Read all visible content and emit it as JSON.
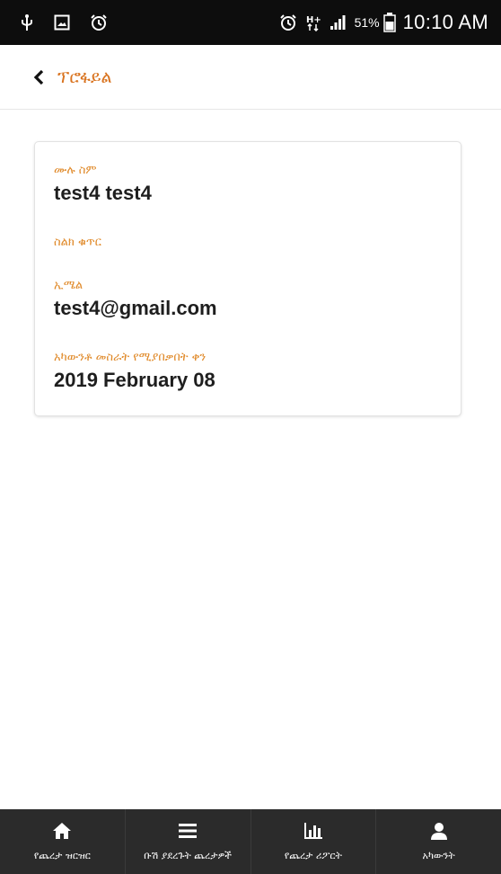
{
  "status_bar": {
    "battery_percent": "51%",
    "time": "10:10 AM",
    "icons": [
      "usb-icon",
      "gallery-icon",
      "alarm-icon",
      "alarm-icon",
      "hplus-data-icon",
      "signal-icon",
      "battery-icon"
    ]
  },
  "header": {
    "back_icon": "chevron-left-icon",
    "title": "ፕሮፋይል"
  },
  "profile": {
    "full_name_label": "ሙሉ ስም",
    "full_name_value": "test4 test4",
    "phone_label": "ስልክ ቁጥር",
    "phone_value": "",
    "email_label": "ኢሜል",
    "email_value": "test4@gmail.com",
    "expiry_label": "አካውንቶ መስራት የሚያበቃበት ቀን",
    "expiry_value": "2019 February 08"
  },
  "bottom_nav": {
    "items": [
      {
        "label": "የጨረታ ዝርዝር",
        "icon": "home-icon"
      },
      {
        "label": "ቡሽ ያደረጉት ጨረታዎች",
        "icon": "menu-icon"
      },
      {
        "label": "የጨረታ ሪፖርት",
        "icon": "bar-chart-icon"
      },
      {
        "label": "አካውንት",
        "icon": "user-icon"
      }
    ]
  },
  "colors": {
    "accent": "#d9731f",
    "status_bar_bg": "#0d0d0d",
    "nav_bg": "#2b2b2b"
  }
}
